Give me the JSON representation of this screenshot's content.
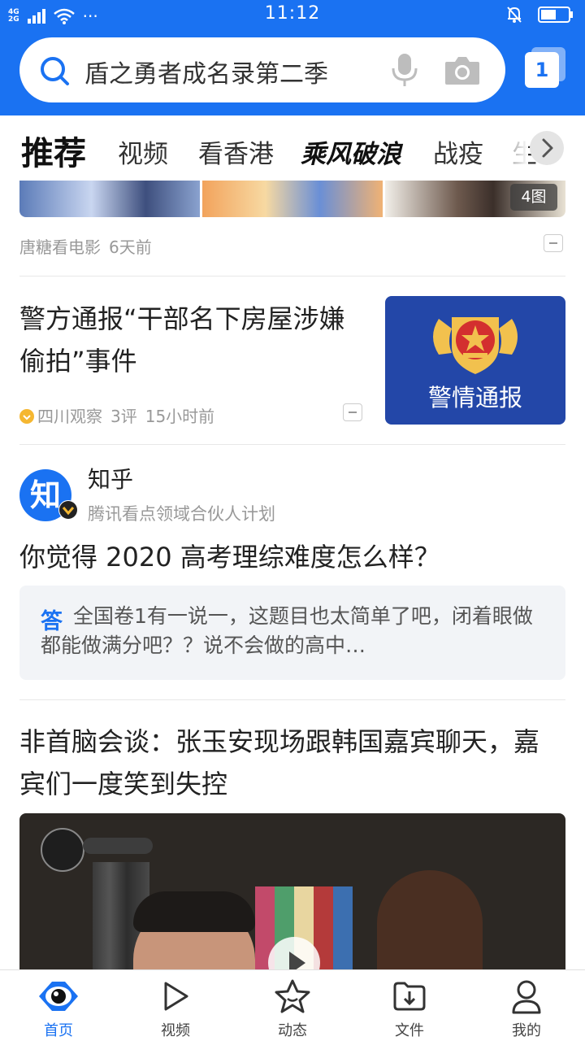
{
  "status_bar": {
    "network_top": "4G",
    "network_bottom": "2G",
    "dots": "···",
    "time": "11:12"
  },
  "search": {
    "query": "盾之勇者成名录第二季",
    "tab_count": "1"
  },
  "channels": [
    {
      "label": "推荐"
    },
    {
      "label": "视频"
    },
    {
      "label": "看香港"
    },
    {
      "label": "乘风破浪"
    },
    {
      "label": "战疫"
    },
    {
      "label": "生"
    }
  ],
  "feed": {
    "item1": {
      "image_count": "4图",
      "source": "唐糖看电影",
      "time": "6天前"
    },
    "item2": {
      "title": "警方通报“干部名下房屋涉嫌偷拍”事件",
      "image_text": "警情通报",
      "source": "四川观察",
      "comments": "3评",
      "time": "15小时前"
    },
    "item3": {
      "avatar_text": "知",
      "source_name": "知乎",
      "source_desc": "腾讯看点领域合伙人计划",
      "title": "你觉得 2020 高考理综难度怎么样？",
      "answer_tag": "答",
      "answer_text": "全国卷1有一说一，这题目也太简单了吧，闭着眼做都能做满分吧？？说不会做的高中…"
    },
    "item4": {
      "title": "非首脑会谈：张玉安现场跟韩国嘉宾聊天，嘉宾们一度笑到失控"
    }
  },
  "bottom_nav": [
    {
      "label": "首页",
      "icon": "home-eye-icon",
      "active": true
    },
    {
      "label": "视频",
      "icon": "play-icon",
      "active": false
    },
    {
      "label": "动态",
      "icon": "star-icon",
      "active": false
    },
    {
      "label": "文件",
      "icon": "download-folder-icon",
      "active": false
    },
    {
      "label": "我的",
      "icon": "user-icon",
      "active": false
    }
  ],
  "colors": {
    "brand_blue": "#1a72f2",
    "police_blue": "#2347a8"
  }
}
